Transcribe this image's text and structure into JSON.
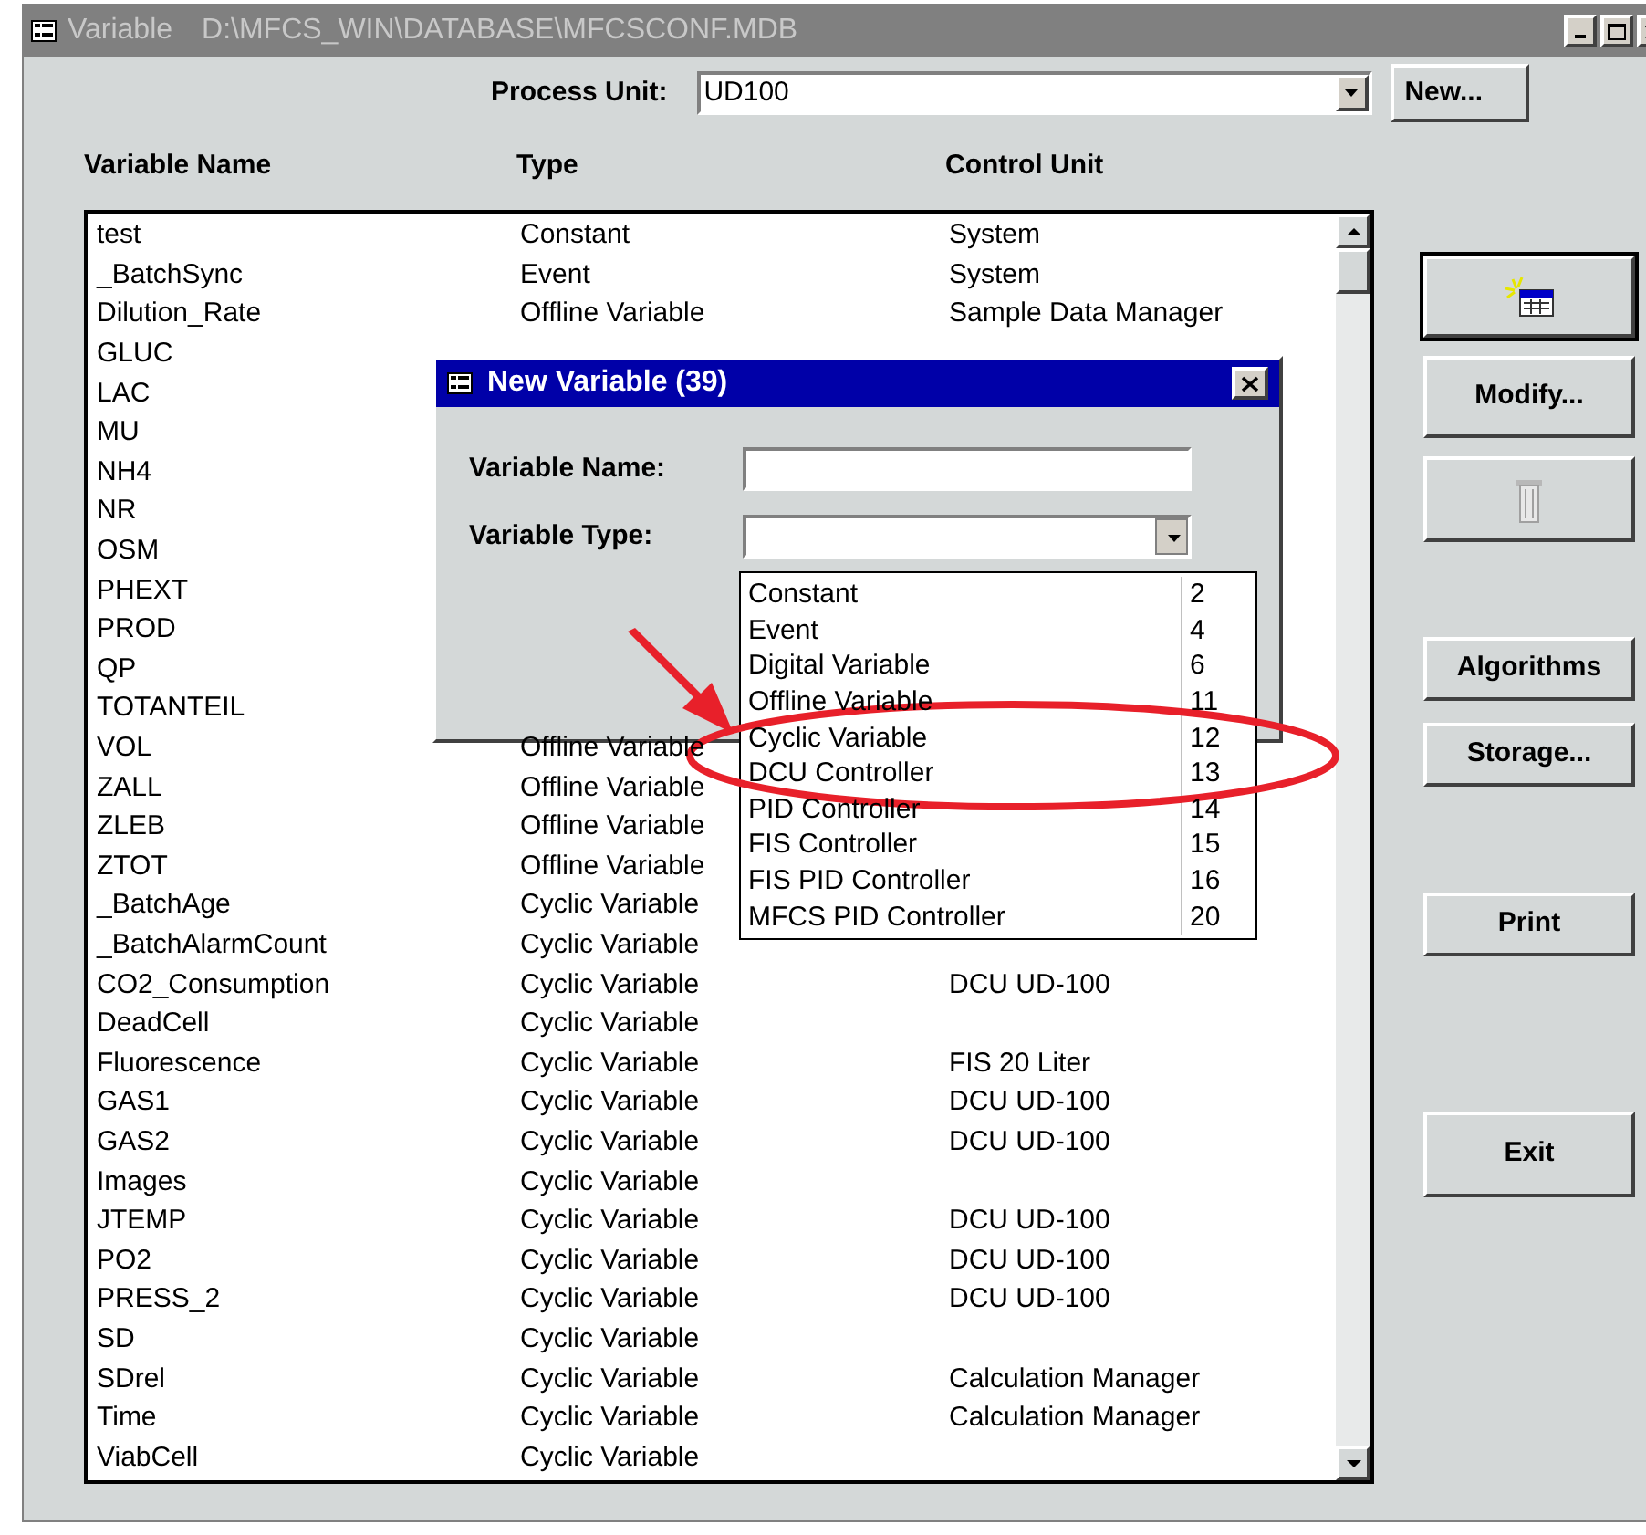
{
  "window": {
    "title": "Variable",
    "path": "D:\\MFCS_WIN\\DATABASE\\MFCSCONF.MDB",
    "active": false
  },
  "process_unit": {
    "label": "Process Unit:",
    "value": "UD100"
  },
  "new_process_button": "New...",
  "table": {
    "columns": [
      "Variable Name",
      "Type",
      "Control Unit"
    ],
    "rows": [
      {
        "name": "test",
        "type": "Constant",
        "control_unit": "System"
      },
      {
        "name": "_BatchSync",
        "type": "Event",
        "control_unit": "System"
      },
      {
        "name": "Dilution_Rate",
        "type": "Offline Variable",
        "control_unit": "Sample Data Manager"
      },
      {
        "name": "GLUC"
      },
      {
        "name": "LAC"
      },
      {
        "name": "MU"
      },
      {
        "name": "NH4"
      },
      {
        "name": "NR"
      },
      {
        "name": "OSM"
      },
      {
        "name": "PHEXT"
      },
      {
        "name": "PROD"
      },
      {
        "name": "QP"
      },
      {
        "name": "TOTANTEIL"
      },
      {
        "name": "VOL",
        "type": "Offline Variable"
      },
      {
        "name": "ZALL",
        "type": "Offline Variable"
      },
      {
        "name": "ZLEB",
        "type": "Offline Variable"
      },
      {
        "name": "ZTOT",
        "type": "Offline Variable"
      },
      {
        "name": "_BatchAge",
        "type": "Cyclic Variable"
      },
      {
        "name": "_BatchAlarmCount",
        "type": "Cyclic Variable"
      },
      {
        "name": "CO2_Consumption",
        "type": "Cyclic Variable",
        "control_unit": "DCU UD-100"
      },
      {
        "name": "DeadCell",
        "type": "Cyclic Variable"
      },
      {
        "name": "Fluorescence",
        "type": "Cyclic Variable",
        "control_unit": "FIS 20 Liter"
      },
      {
        "name": "GAS1",
        "type": "Cyclic Variable",
        "control_unit": "DCU UD-100"
      },
      {
        "name": "GAS2",
        "type": "Cyclic Variable",
        "control_unit": "DCU UD-100"
      },
      {
        "name": "Images",
        "type": "Cyclic Variable"
      },
      {
        "name": "JTEMP",
        "type": "Cyclic Variable",
        "control_unit": "DCU UD-100"
      },
      {
        "name": "PO2",
        "type": "Cyclic Variable",
        "control_unit": "DCU UD-100"
      },
      {
        "name": "PRESS_2",
        "type": "Cyclic Variable",
        "control_unit": "DCU UD-100"
      },
      {
        "name": "SD",
        "type": "Cyclic Variable"
      },
      {
        "name": "SDrel",
        "type": "Cyclic Variable",
        "control_unit": "Calculation Manager"
      },
      {
        "name": "Time",
        "type": "Cyclic Variable",
        "control_unit": "Calculation Manager"
      },
      {
        "name": "ViabCell",
        "type": "Cyclic Variable"
      }
    ]
  },
  "button_groups": [
    [
      {
        "kind": "new",
        "disabled": false,
        "default": true
      },
      {
        "kind": "text",
        "label": "Modify...",
        "disabled": false,
        "default": false
      },
      {
        "kind": "delete",
        "disabled": true,
        "default": false
      }
    ],
    [
      {
        "kind": "text",
        "label": "Algorithms",
        "disabled": false,
        "default": false
      },
      {
        "kind": "text",
        "label": "Storage...",
        "disabled": false,
        "default": false
      }
    ],
    [
      {
        "kind": "text",
        "label": "Print",
        "disabled": false,
        "default": false
      }
    ],
    [
      {
        "kind": "text",
        "label": "Exit",
        "disabled": false,
        "default": false
      }
    ]
  ],
  "dialog": {
    "title": "New Variable (39)",
    "active": true,
    "variable_name": {
      "label": "Variable Name:"
    },
    "variable_type": {
      "label": "Variable Type:",
      "expanded": true,
      "options": [
        {
          "name": "Constant",
          "code": "2"
        },
        {
          "name": "Event",
          "code": "4"
        },
        {
          "name": "Digital Variable",
          "code": "6"
        },
        {
          "name": "Offline Variable",
          "code": "11"
        },
        {
          "name": "Cyclic Variable",
          "code": "12"
        },
        {
          "name": "DCU Controller",
          "code": "13"
        },
        {
          "name": "PID Controller",
          "code": "14"
        },
        {
          "name": "FIS Controller",
          "code": "15"
        },
        {
          "name": "FIS PID Controller",
          "code": "16"
        },
        {
          "name": "MFCS PID Controller",
          "code": "20"
        }
      ]
    }
  }
}
